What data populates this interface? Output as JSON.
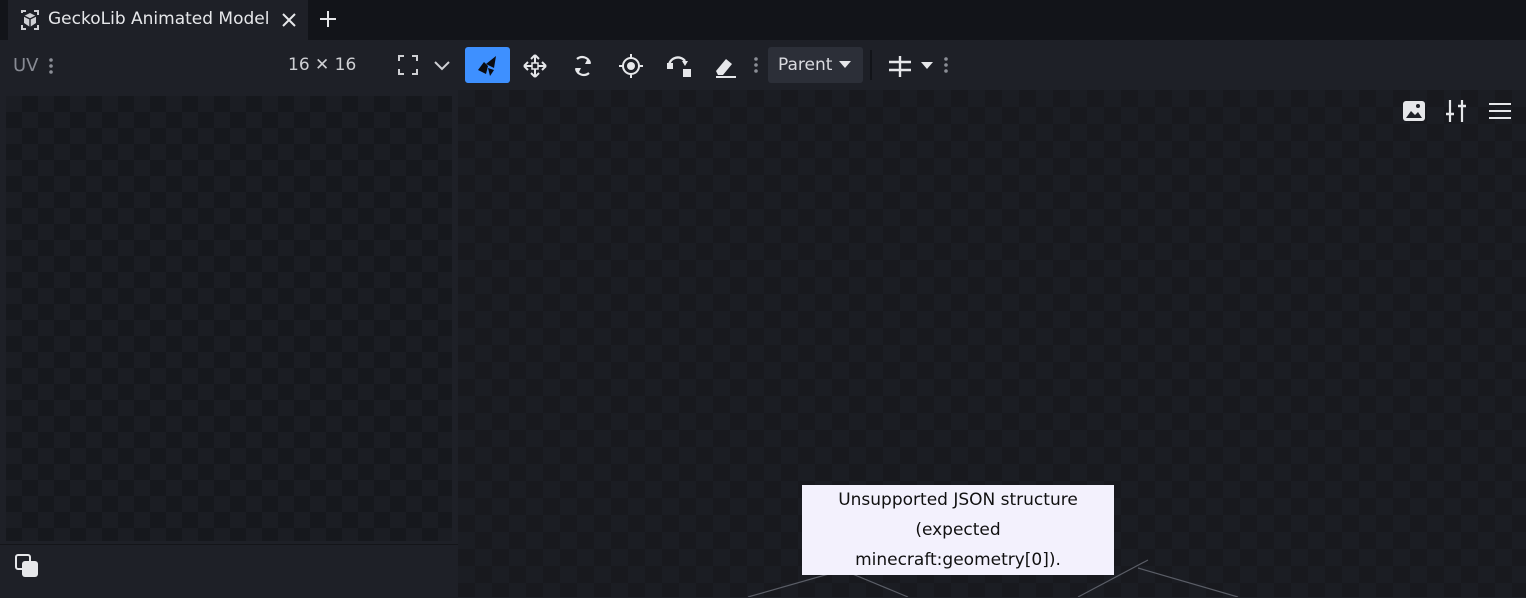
{
  "tabs": [
    {
      "label": "GeckoLib Animated Model",
      "icon": "cube-icon"
    }
  ],
  "tabbar": {
    "new_tab_icon": "plus-icon",
    "close_icon": "close-icon"
  },
  "uv_panel": {
    "title": "UV",
    "size": "16 ✕ 16",
    "fullscreen_icon": "fullscreen-icon",
    "menu_icon": "chevron-down-icon",
    "bottom_icon": "copy-icon"
  },
  "toolbar": {
    "tools": [
      {
        "name": "move-tool-icon",
        "active": true
      },
      {
        "name": "arrows-move-icon",
        "active": false
      },
      {
        "name": "rotate-icon",
        "active": false
      },
      {
        "name": "pivot-icon",
        "active": false
      },
      {
        "name": "vertex-snap-icon",
        "active": false
      },
      {
        "name": "eraser-icon",
        "active": false
      }
    ],
    "space_select": "Parent",
    "grid_snap_icon": "grid-snap-icon"
  },
  "viewport": {
    "icons": [
      "image-icon",
      "sliders-icon",
      "menu-icon"
    ],
    "error_lines": [
      "Unsupported JSON structure",
      "(expected",
      "minecraft:geometry[0])."
    ]
  },
  "colors": {
    "accent": "#3e90ff",
    "background": "#1e2027",
    "tabbar": "#121419"
  }
}
